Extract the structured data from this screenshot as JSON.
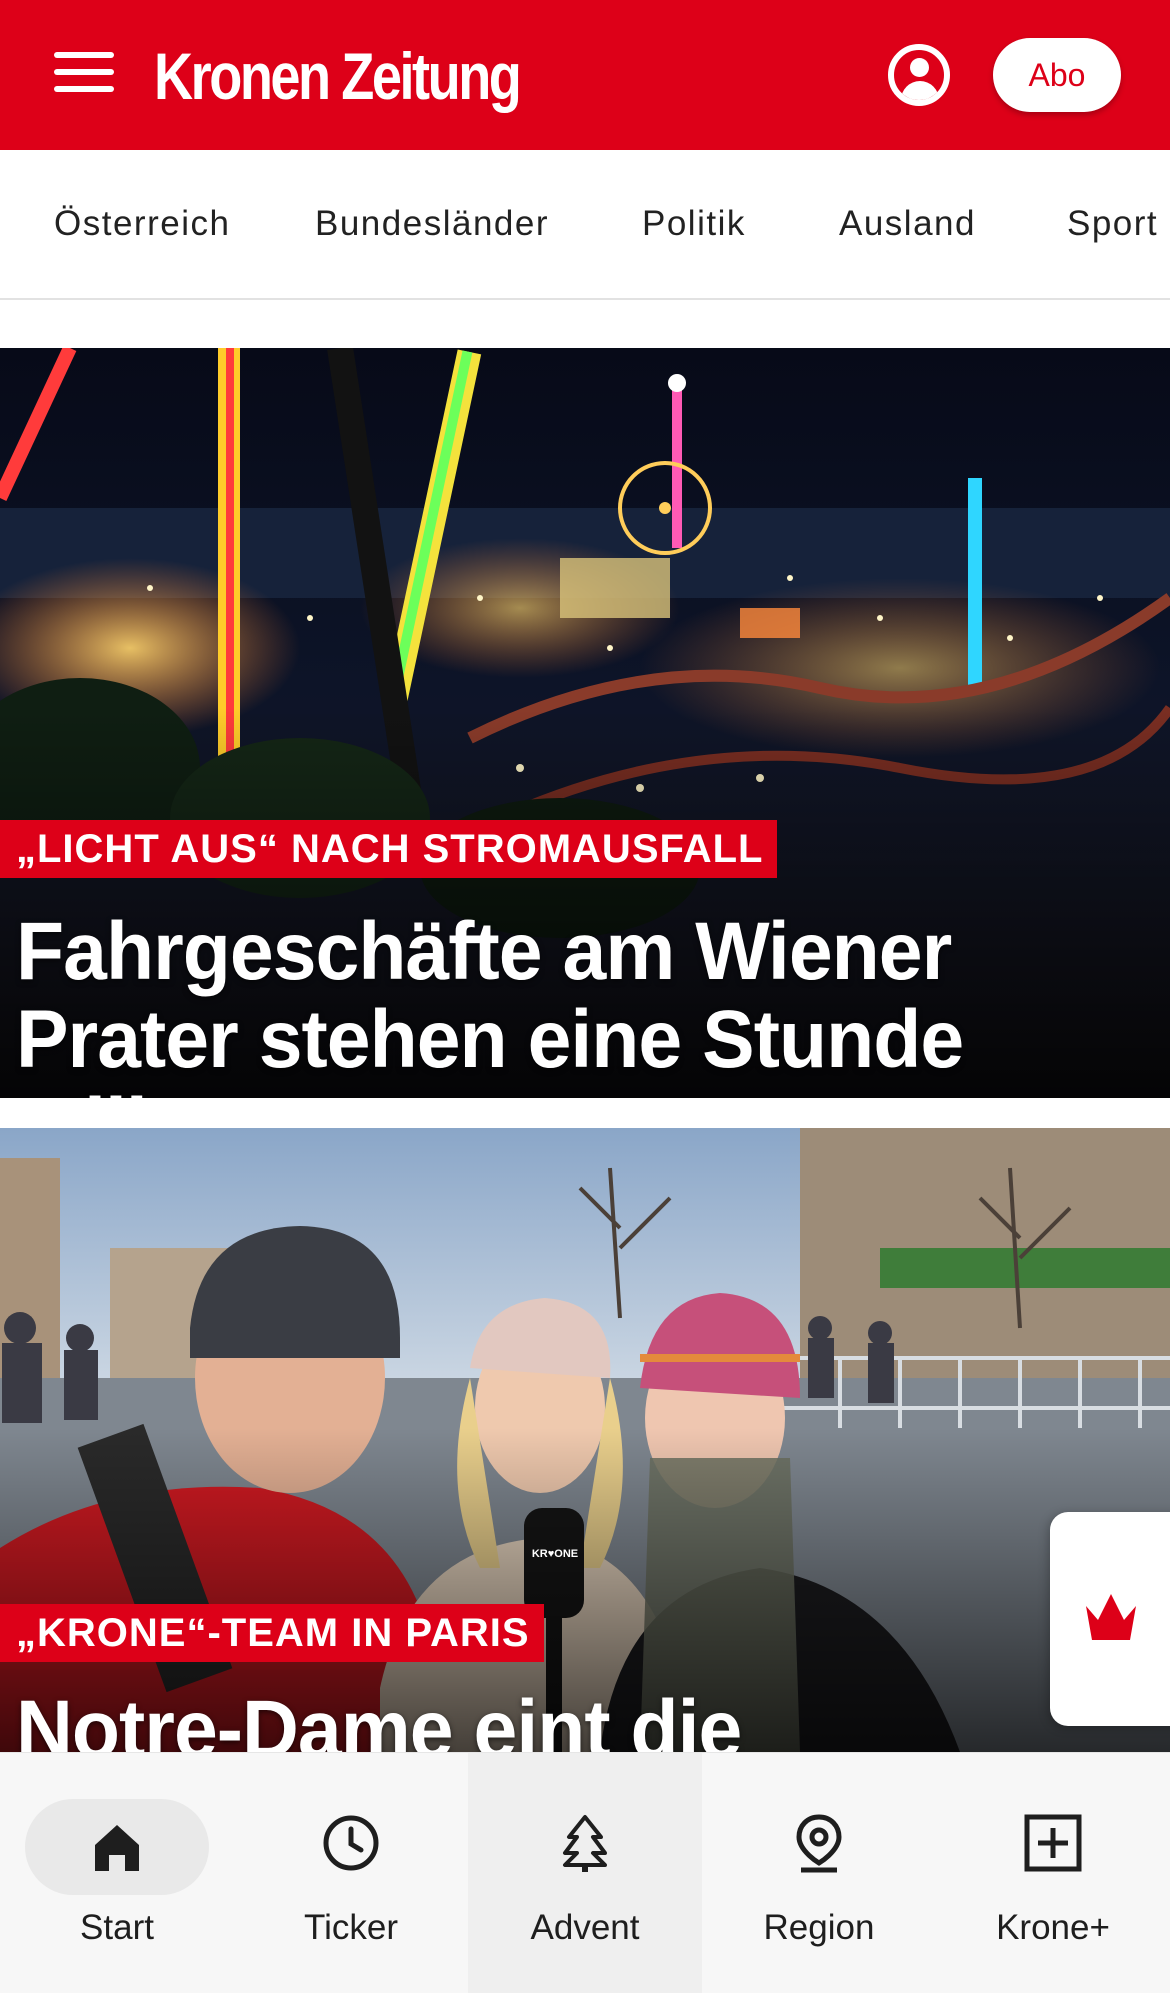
{
  "app": {
    "logo_text": "Kronen Zeitung",
    "brand_color": "#dd0018",
    "abo_label": "Abo"
  },
  "nav": {
    "items": [
      "Österreich",
      "Bundesländer",
      "Politik",
      "Ausland",
      "Sport"
    ]
  },
  "articles": [
    {
      "kicker": "„LICHT AUS“ NACH STROMAUSFALL",
      "headline": "Fahrgeschäfte am Wiener Prater stehen eine Stunde still"
    },
    {
      "kicker": "„KRONE“-TEAM IN PARIS",
      "headline": "Notre-Dame eint die",
      "mic_text": "KR♥ONE"
    }
  ],
  "bottom_nav": {
    "tabs": [
      {
        "label": "Start",
        "icon": "home-icon",
        "active": true
      },
      {
        "label": "Ticker",
        "icon": "clock-icon"
      },
      {
        "label": "Advent",
        "icon": "tree-icon"
      },
      {
        "label": "Region",
        "icon": "location-pin-icon"
      },
      {
        "label": "Krone+",
        "icon": "plus-box-icon"
      }
    ]
  }
}
